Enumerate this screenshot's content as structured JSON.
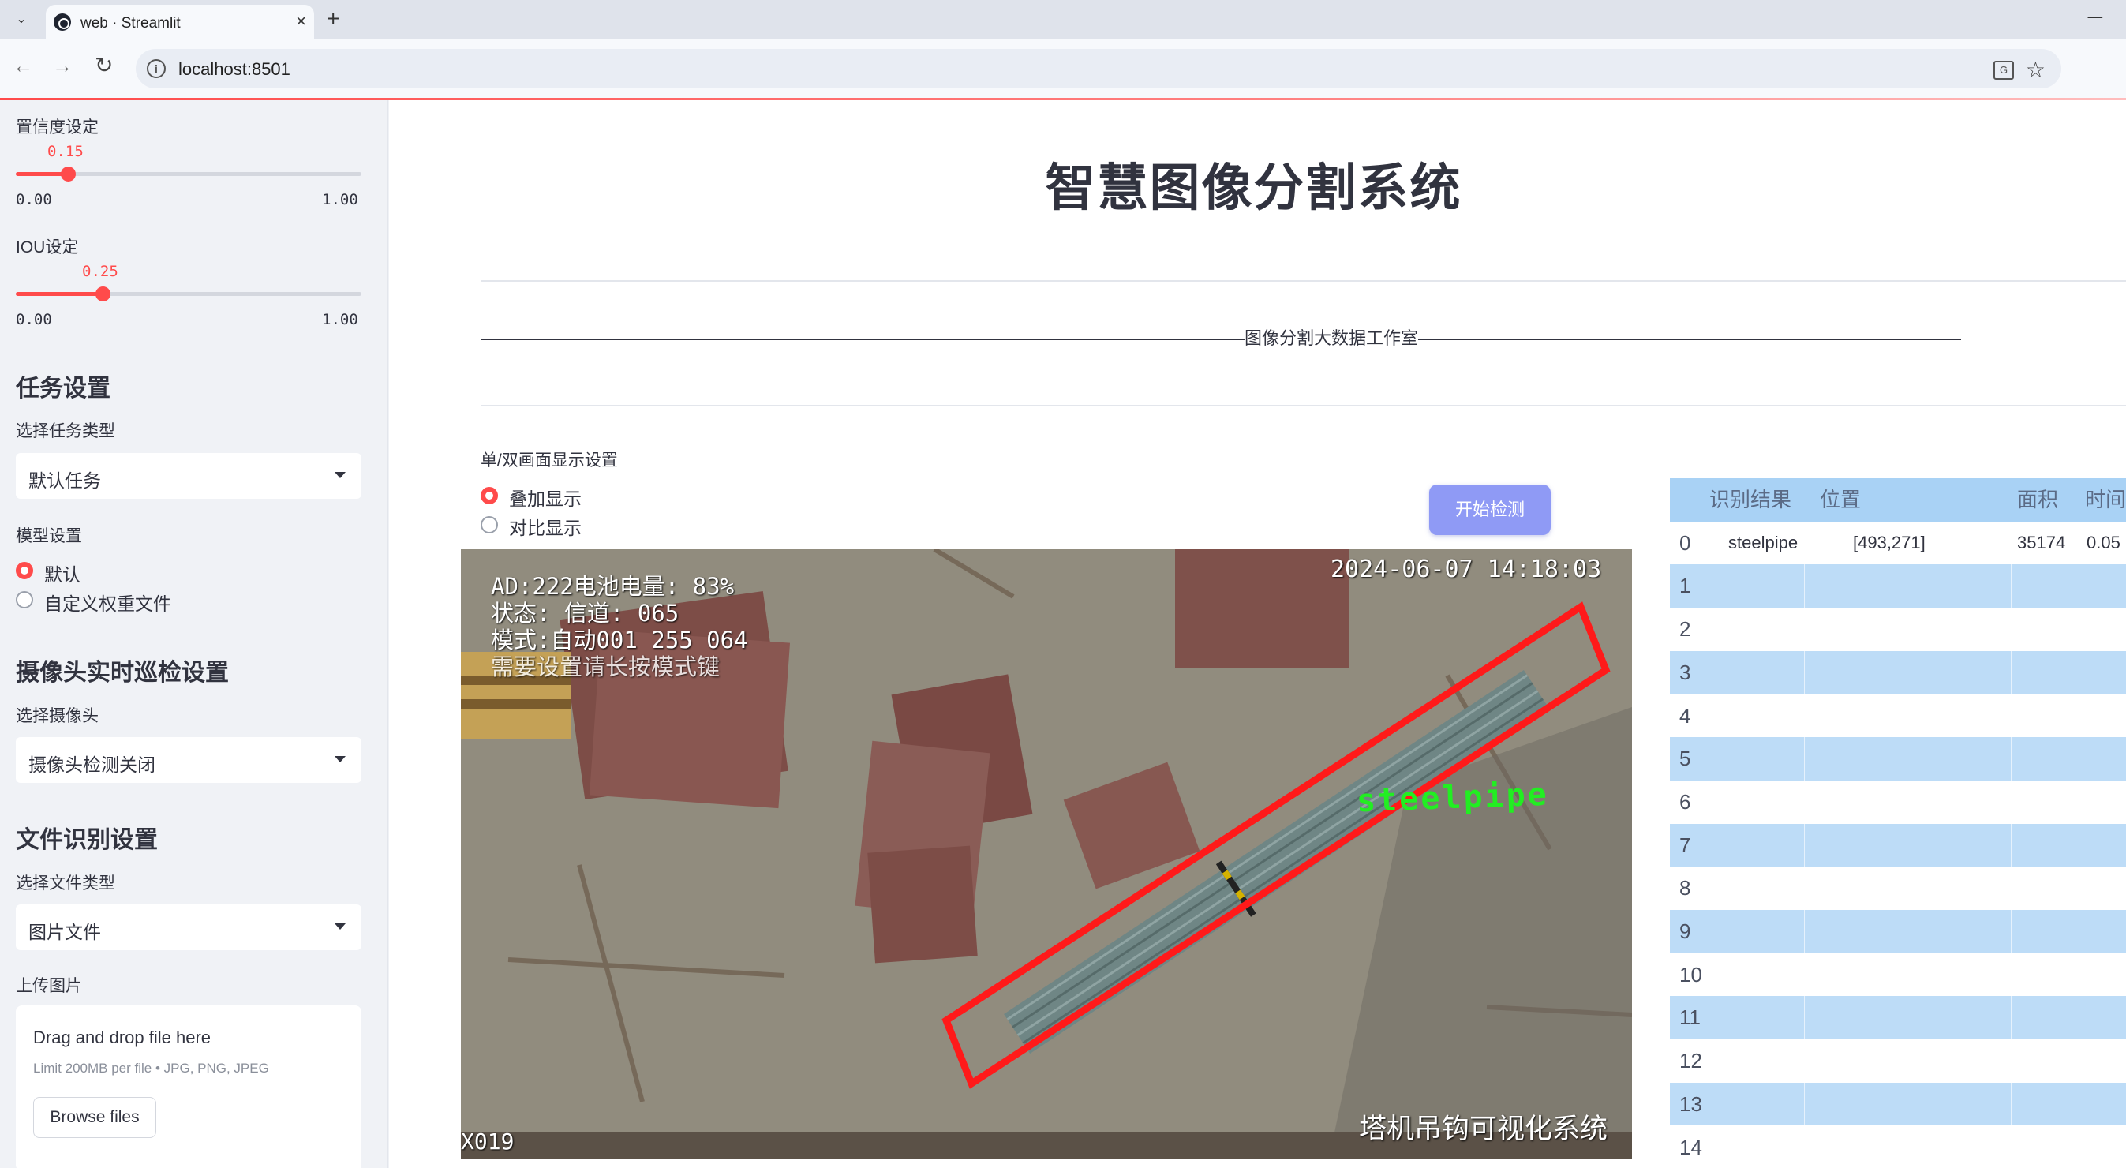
{
  "browser": {
    "tab_title": "web · Streamlit",
    "url": "localhost:8501",
    "new_tab": "+",
    "close": "×",
    "minimize": "─",
    "back": "←",
    "forward": "→",
    "reload": "↻",
    "star": "☆",
    "menu": "⌄",
    "info": "i",
    "translate": "G"
  },
  "sidebar": {
    "confidence": {
      "label": "置信度设定",
      "value_text": "0.15",
      "value": 0.15,
      "min": "0.00",
      "max": "1.00"
    },
    "iou": {
      "label": "IOU设定",
      "value_text": "0.25",
      "value": 0.25,
      "min": "0.00",
      "max": "1.00"
    },
    "task_heading": "任务设置",
    "task_type_label": "选择任务类型",
    "task_type_value": "默认任务",
    "model_label": "模型设置",
    "model_options": [
      "默认",
      "自定义权重文件"
    ],
    "camera_heading": "摄像头实时巡检设置",
    "camera_label": "选择摄像头",
    "camera_value": "摄像头检测关闭",
    "file_heading": "文件识别设置",
    "file_type_label": "选择文件类型",
    "file_type_value": "图片文件",
    "upload_label": "上传图片",
    "upload_title": "Drag and drop file here",
    "upload_limit": "Limit 200MB per file • JPG, PNG, JPEG",
    "browse_label": "Browse files"
  },
  "main": {
    "title": "智慧图像分割系统",
    "banner": "————————————————————————————————————————————图像分割大数据工作室————————————————————————————————————————————",
    "mode_label": "单/双画面显示设置",
    "mode_options": [
      "叠加显示",
      "对比显示"
    ],
    "start_button": "开始检测"
  },
  "camera": {
    "osd_line1": "AD:222电池电量: 83%",
    "osd_line2": "状态:      信道: 065",
    "osd_line3": "模式:自动001 255 064",
    "osd_line4": "需要设置请长按模式键",
    "timestamp": "2024-06-07 14:18:03",
    "channel": "X019",
    "system_name": "塔机吊钩可视化系统",
    "detection_label": "steelpipe"
  },
  "results": {
    "headers": [
      "识别结果",
      "位置",
      "面积",
      "时间"
    ],
    "row_indices": [
      "0",
      "1",
      "2",
      "3",
      "4",
      "5",
      "6",
      "7",
      "8",
      "9",
      "10",
      "11",
      "12",
      "13",
      "14"
    ],
    "row0": {
      "label": "steelpipe",
      "position": "[493,271]",
      "area": "35174",
      "time": "0.05"
    }
  },
  "colors": {
    "accent": "#ff4b4b",
    "button": "#8f9af5",
    "table_header": "#a9d2f5",
    "table_alt": "#bddcf7",
    "detection_box": "#ff1a1a",
    "detection_text": "#22ee22"
  }
}
